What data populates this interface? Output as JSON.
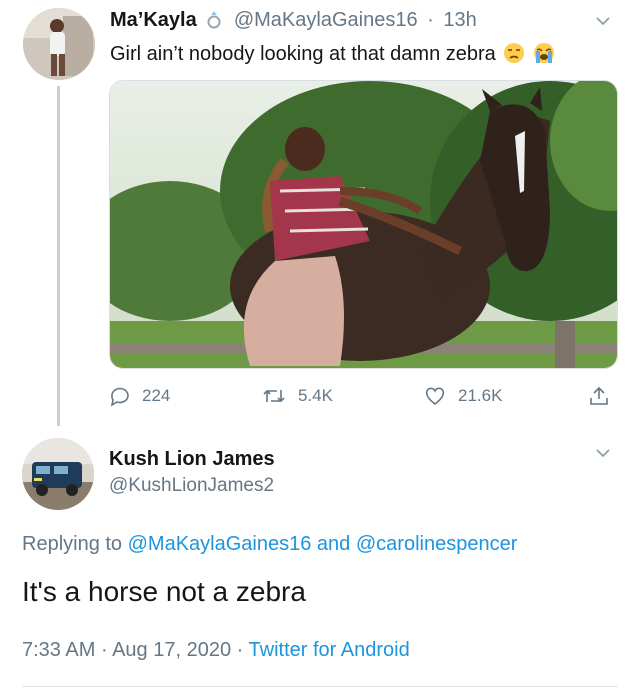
{
  "tweet": {
    "display_name": "Ma’Kayla",
    "handle": "@MaKaylaGaines16",
    "separator": "·",
    "time_ago": "13h",
    "text": "Girl ain’t nobody looking at that damn zebra",
    "emojis": [
      "unamused-face-icon",
      "loudly-crying-face-icon"
    ],
    "badge_icon": "ring-icon",
    "actions": {
      "replies": "224",
      "retweets": "5.4K",
      "likes": "21.6K"
    }
  },
  "reply": {
    "display_name": "Kush Lion James",
    "handle": "@KushLionJames2",
    "replying_prefix": "Replying to",
    "replying_user_1": "@MaKaylaGaines16",
    "replying_conj": "and",
    "replying_user_2": "@carolinespencer",
    "text": "It's a horse not a zebra",
    "time": "7:33 AM",
    "date": "Aug 17, 2020",
    "source": "Twitter for Android",
    "dot": "·"
  },
  "colors": {
    "text": "#14171a",
    "secondary": "#657786",
    "link": "#1b95e0",
    "thread_line": "#c4cfd6"
  }
}
